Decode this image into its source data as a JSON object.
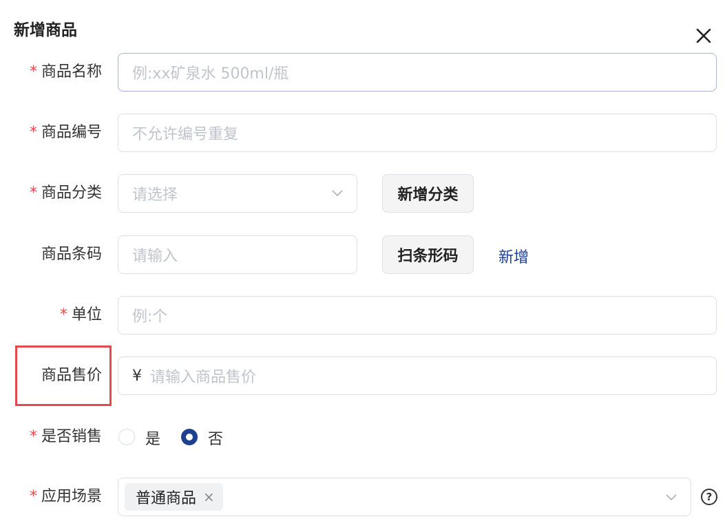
{
  "dialog": {
    "title": "新增商品",
    "close_icon": "close-icon",
    "required_mark": "*"
  },
  "fields": {
    "name": {
      "label": "商品名称",
      "required": true,
      "placeholder": "例:xx矿泉水 500ml/瓶"
    },
    "code": {
      "label": "商品编号",
      "required": true,
      "placeholder": "不允许编号重复"
    },
    "category": {
      "label": "商品分类",
      "required": true,
      "placeholder": "请选择",
      "add_button": "新增分类"
    },
    "barcode": {
      "label": "商品条码",
      "required": false,
      "placeholder": "请输入",
      "scan_button": "扫条形码",
      "add_link": "新增"
    },
    "unit": {
      "label": "单位",
      "required": true,
      "placeholder": "例:个"
    },
    "price": {
      "label": "商品售价",
      "required": false,
      "currency": "¥",
      "placeholder": "请输入商品售价"
    },
    "on_sale": {
      "label": "是否销售",
      "required": true,
      "options": [
        "是",
        "否"
      ],
      "selected": "否"
    },
    "scene": {
      "label": "应用场景",
      "required": true,
      "tags": [
        "普通商品"
      ],
      "tag_remove": "×",
      "help": "?"
    }
  },
  "colors": {
    "accent": "#1f3f8f",
    "required": "#e5484d",
    "highlight": "#e5484d",
    "border": "#dcdfe6",
    "placeholder": "#c0c4cc"
  }
}
